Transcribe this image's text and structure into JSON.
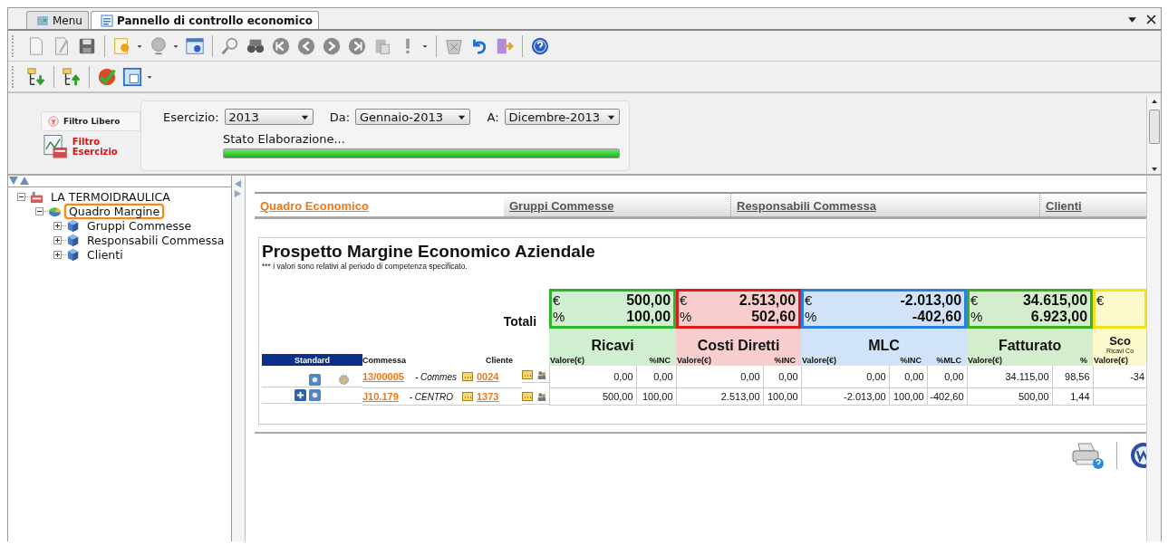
{
  "window": {
    "tabs": [
      {
        "label": "Menu",
        "selected": false
      },
      {
        "label": "Pannello di controllo economico",
        "selected": true
      }
    ]
  },
  "filter": {
    "modes": [
      {
        "label": "Filtro Libero",
        "selected": false
      },
      {
        "label": "Filtro Esercizio",
        "selected": true
      }
    ],
    "fields": [
      {
        "label": "Esercizio:",
        "value": "2013"
      },
      {
        "label": "Da:",
        "value": "Gennaio-2013"
      },
      {
        "label": "A:",
        "value": "Dicembre-2013"
      }
    ],
    "status": {
      "label": "Stato Elaborazione...",
      "level": 1
    }
  },
  "tree": [
    {
      "label": "LA TERMOIDRAULICA",
      "kind": "company",
      "expanded": true,
      "selected": false,
      "children": [
        {
          "label": "Quadro Margine",
          "kind": "chart",
          "expanded": true,
          "selected": true,
          "children": [
            {
              "label": "Gruppi Commesse",
              "kind": "cube",
              "expanded": false,
              "selected": false
            },
            {
              "label": "Responsabili Commessa",
              "kind": "cube",
              "expanded": false,
              "selected": false
            },
            {
              "label": "Clienti",
              "kind": "cube",
              "expanded": false,
              "selected": false
            }
          ]
        }
      ]
    }
  ],
  "report": {
    "tabs": [
      {
        "label": "Quadro Economico",
        "selected": true
      },
      {
        "label": "Gruppi Commesse",
        "selected": false
      },
      {
        "label": "Responsabili Commessa",
        "selected": false
      },
      {
        "label": "Clienti",
        "selected": false
      }
    ],
    "title": "Prospetto Margine Economico Aziendale",
    "note": "*** i valori sono relativi al periodo di competenza specificato.",
    "totals_label": "Totali",
    "left_columns": [
      "Standard",
      "Commessa",
      "Cliente"
    ],
    "groups": [
      {
        "title": "Ricavi",
        "color": "#2bb52b",
        "columns": [
          "Valore(€)",
          "%INC"
        ],
        "total": {
          "currency": "€",
          "amount": "500,00",
          "percent_sign": "%",
          "percent": "100,00"
        }
      },
      {
        "title": "Costi Diretti",
        "color": "#e01b1b",
        "columns": [
          "Valore(€)",
          "%INC"
        ],
        "total": {
          "currency": "€",
          "amount": "2.513,00",
          "percent_sign": "%",
          "percent": "502,60"
        }
      },
      {
        "title": "MLC",
        "color": "#2a7fe0",
        "columns": [
          "Valore(€)",
          "%INC",
          "%MLC"
        ],
        "total": {
          "currency": "€",
          "amount": "-2.013,00",
          "percent_sign": "%",
          "percent": "-402,60"
        }
      },
      {
        "title": "Fatturato",
        "color": "#3cb01c",
        "columns": [
          "Valore(€)",
          "%"
        ],
        "total": {
          "currency": "€",
          "amount": "34.615,00",
          "percent_sign": "%",
          "percent": "6.923,00"
        }
      },
      {
        "title": "Sco",
        "subtitle": "Ricavi Co",
        "color": "#f2e21a",
        "columns": [
          "Valore(€)"
        ],
        "total": {
          "currency": "€"
        }
      }
    ],
    "rows": [
      {
        "expandable": false,
        "configured": true,
        "commessa": "13/00005",
        "description": "- Commes",
        "cliente": "0024",
        "values": [
          "0,00",
          "0,00",
          "0,00",
          "0,00",
          "0,00",
          "0,00",
          "0,00",
          "34.115,00",
          "98,56",
          "-34"
        ]
      },
      {
        "expandable": true,
        "configured": false,
        "commessa": "J10.179",
        "description": "- CENTRO",
        "cliente": "1373",
        "values": [
          "500,00",
          "100,00",
          "2.513,00",
          "100,00",
          "-2.013,00",
          "100,00",
          "-402,60",
          "500,00",
          "1,44"
        ]
      }
    ]
  }
}
